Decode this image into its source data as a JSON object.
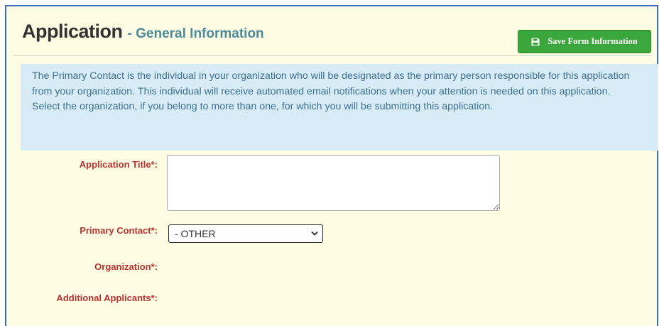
{
  "header": {
    "title": "Application",
    "subtitle": "- General Information",
    "save_label": "Save Form Information"
  },
  "info": {
    "paragraph1": "The Primary Contact is the individual in your organization who will be designated as the primary person responsible for this application from your organization. This individual will receive automated email notifications when your attention is needed on this application.",
    "paragraph2": "Select the organization, if you belong to more than one, for which you will be submitting this application."
  },
  "form": {
    "application_title_label": "Application Title*:",
    "application_title_value": "",
    "primary_contact_label": "Primary Contact*:",
    "primary_contact_value": "- OTHER",
    "organization_label": "Organization*:",
    "additional_applicants_label": "Additional Applicants*:"
  },
  "colors": {
    "panel_bg": "#fefde3",
    "panel_border": "#3a6fc0",
    "save_button": "#3ba63b",
    "info_bg": "#d7ecf6",
    "label_red": "#b83232",
    "subtitle": "#4a8a9a"
  },
  "icons": {
    "save": "floppy-disk-icon",
    "dropdown": "chevron-down-icon"
  }
}
